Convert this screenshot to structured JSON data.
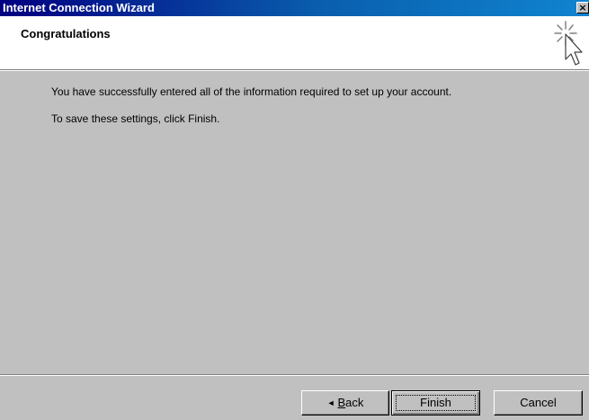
{
  "window": {
    "title": "Internet Connection Wizard",
    "close_label": "×"
  },
  "header": {
    "title": "Congratulations",
    "icon": "wizard-cursor-sparkle-icon"
  },
  "body": {
    "line1": "You have successfully entered all of the information required to set up your account.",
    "line2": "To save these settings, click Finish."
  },
  "buttons": {
    "back_arrow": "◄",
    "back_mnemonic": "B",
    "back_rest": "ack",
    "finish": "Finish",
    "cancel": "Cancel"
  },
  "colors": {
    "titlebar_start": "#000080",
    "titlebar_end": "#1084d0",
    "face": "#c0c0c0",
    "header_bg": "#ffffff"
  }
}
